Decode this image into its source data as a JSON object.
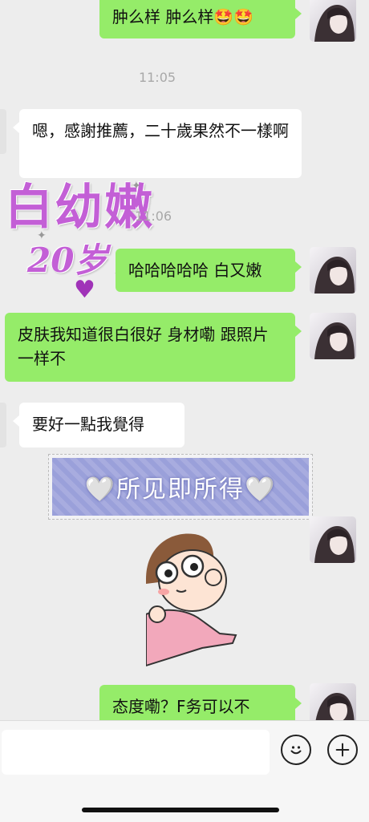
{
  "messages": {
    "m1": "肿么样 肿么样🤩🤩",
    "t1": "11:05",
    "m2": "嗯，感謝推薦，二十歲果然不一樣啊",
    "sticker1_line1": "白幼嫩",
    "sticker1_line2": "20岁",
    "t2": "11:06",
    "m3": "哈哈哈哈哈 白又嫩",
    "m4": "皮肤我知道很白很好 身材嘞 跟照片一样不",
    "m5": "要好一點我覺得",
    "banner": "🤍所见即所得🤍",
    "m6": "态度嘞？F务可以不"
  },
  "colors": {
    "outgoing": "#95ec69",
    "incoming": "#ffffff",
    "background": "#ededed"
  },
  "icons": {
    "emoji_button": "smiley-icon",
    "plus_button": "plus-icon"
  }
}
